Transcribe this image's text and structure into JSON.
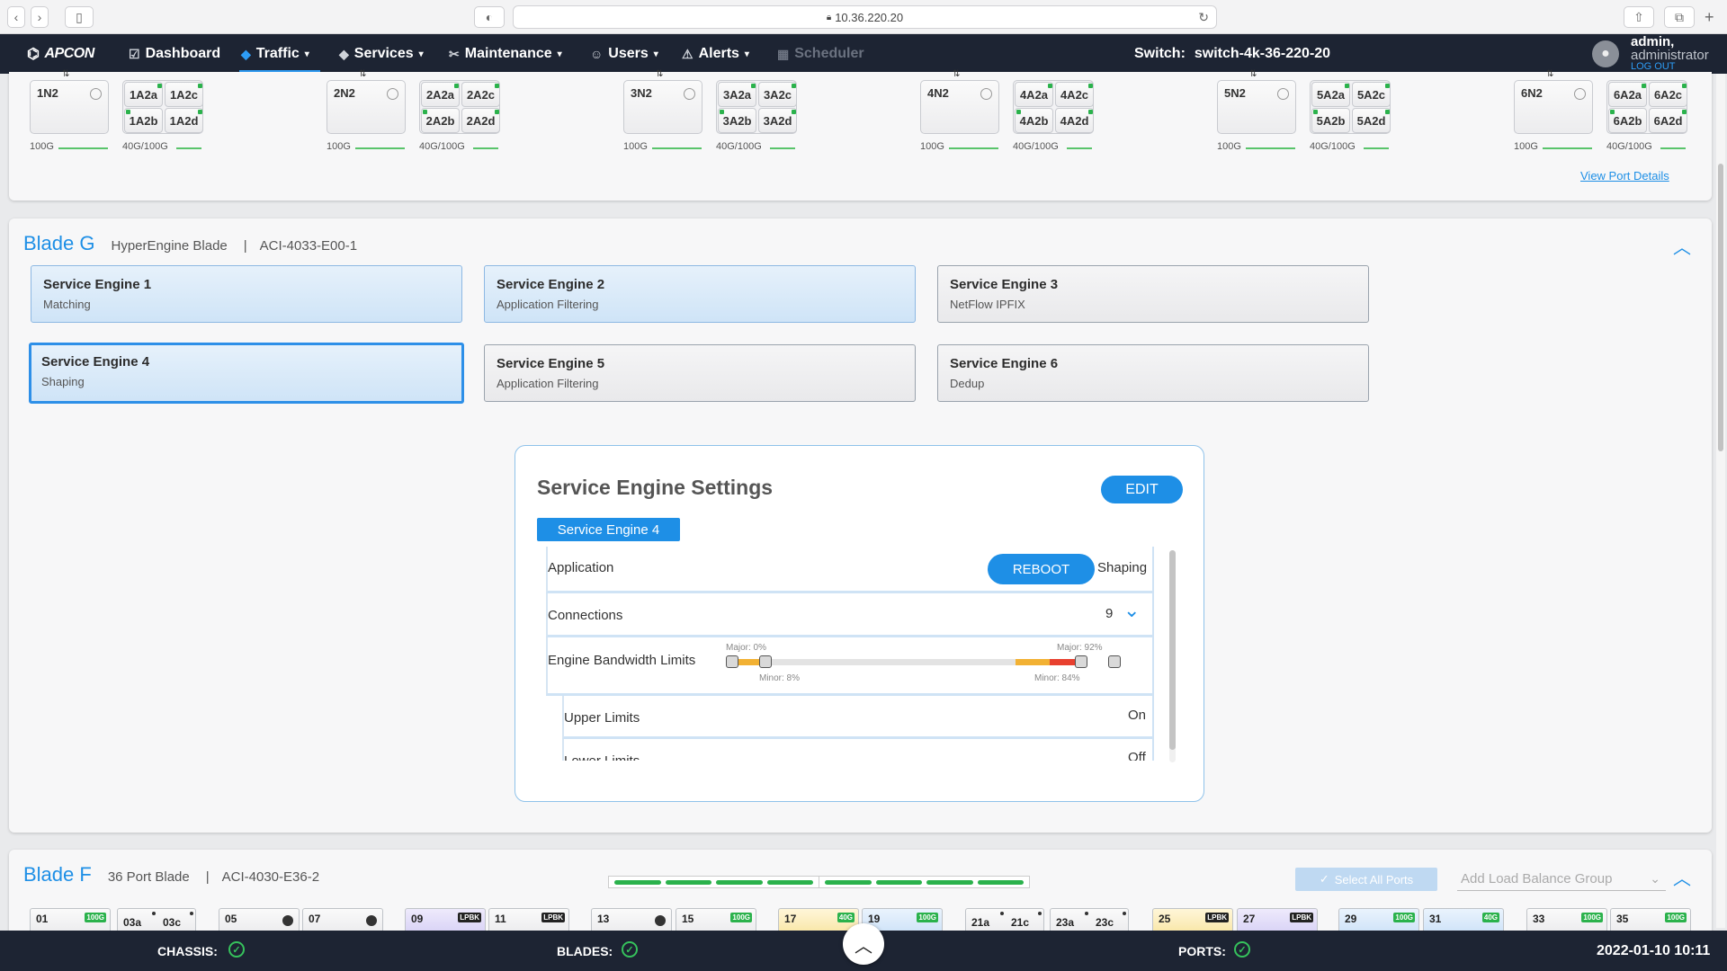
{
  "browser": {
    "url": "10.36.220.20"
  },
  "nav": {
    "logo": "APCON",
    "items": [
      {
        "label": "Dashboard",
        "icon": "dashboard-icon"
      },
      {
        "label": "Traffic",
        "icon": "traffic-icon"
      },
      {
        "label": "Services",
        "icon": "services-icon"
      },
      {
        "label": "Maintenance",
        "icon": "wrench-icon"
      },
      {
        "label": "Users",
        "icon": "users-icon"
      },
      {
        "label": "Alerts",
        "icon": "alert-icon"
      },
      {
        "label": "Scheduler",
        "icon": "calendar-icon"
      }
    ],
    "switch_label": "Switch:",
    "switch_name": "switch-4k-36-220-20",
    "user": "admin,",
    "role": "administrator",
    "logout": "LOG OUT"
  },
  "top_ports": {
    "groups": [
      {
        "n": "1N2",
        "a": [
          "1A2a",
          "1A2c",
          "1A2b",
          "1A2d"
        ],
        "n_speed": "100G",
        "a_speed": "40G/100G"
      },
      {
        "n": "2N2",
        "a": [
          "2A2a",
          "2A2c",
          "2A2b",
          "2A2d"
        ],
        "n_speed": "100G",
        "a_speed": "40G/100G"
      },
      {
        "n": "3N2",
        "a": [
          "3A2a",
          "3A2c",
          "3A2b",
          "3A2d"
        ],
        "n_speed": "100G",
        "a_speed": "40G/100G"
      },
      {
        "n": "4N2",
        "a": [
          "4A2a",
          "4A2c",
          "4A2b",
          "4A2d"
        ],
        "n_speed": "100G",
        "a_speed": "40G/100G"
      },
      {
        "n": "5N2",
        "a": [
          "5A2a",
          "5A2c",
          "5A2b",
          "5A2d"
        ],
        "n_speed": "100G",
        "a_speed": "40G/100G"
      },
      {
        "n": "6N2",
        "a": [
          "6A2a",
          "6A2c",
          "6A2b",
          "6A2d"
        ],
        "n_speed": "100G",
        "a_speed": "40G/100G"
      }
    ],
    "view_details": "View Port Details"
  },
  "blade_g": {
    "title": "Blade G",
    "type": "HyperEngine Blade",
    "sep": "|",
    "model": "ACI-4033-E00-1",
    "engines": [
      {
        "name": "Service Engine 1",
        "app": "Matching"
      },
      {
        "name": "Service Engine 2",
        "app": "Application Filtering"
      },
      {
        "name": "Service Engine 3",
        "app": "NetFlow IPFIX"
      },
      {
        "name": "Service Engine 4",
        "app": "Shaping"
      },
      {
        "name": "Service Engine 5",
        "app": "Application Filtering"
      },
      {
        "name": "Service Engine 6",
        "app": "Dedup"
      }
    ]
  },
  "settings": {
    "title": "Service Engine Settings",
    "edit": "EDIT",
    "tab": "Service Engine 4",
    "application_label": "Application",
    "reboot": "REBOOT",
    "application_value": "Shaping",
    "connections_label": "Connections",
    "connections_value": "9",
    "bandwidth_label": "Engine Bandwidth Limits",
    "major_low": "Major: 0%",
    "minor_low": "Minor: 8%",
    "major_high": "Major: 92%",
    "minor_high": "Minor: 84%",
    "upper_label": "Upper Limits",
    "upper_value": "On",
    "lower_label": "Lower Limits",
    "lower_value": "Off"
  },
  "blade_f": {
    "title": "Blade F",
    "type": "36 Port Blade",
    "sep": "|",
    "model": "ACI-4030-E36-2",
    "select_all": "Select All Ports",
    "add_group_placeholder": "Add Load Balance Group",
    "ports": [
      {
        "label": "01",
        "badge": "100G",
        "badge_color": "#2bb24c"
      },
      {
        "label": "03a",
        "sub": "03c"
      },
      {
        "label": "05",
        "dot": true
      },
      {
        "label": "07",
        "dot": true
      },
      {
        "label": "09",
        "badge": "LPBK",
        "badge_color": "#222",
        "style": "p"
      },
      {
        "label": "11",
        "badge": "LPBK",
        "badge_color": "#222"
      },
      {
        "label": "13",
        "dot": true
      },
      {
        "label": "15",
        "badge": "100G",
        "badge_color": "#2bb24c"
      },
      {
        "label": "17",
        "badge": "40G",
        "badge_color": "#2bb24c",
        "style": "y"
      },
      {
        "label": "19",
        "badge": "100G",
        "badge_color": "#2bb24c",
        "style": "b"
      },
      {
        "label": "21a",
        "sub": "21c"
      },
      {
        "label": "23a",
        "sub": "23c"
      },
      {
        "label": "25",
        "badge": "LPBK",
        "badge_color": "#222",
        "style": "y"
      },
      {
        "label": "27",
        "badge": "LPBK",
        "badge_color": "#222",
        "style": "p"
      },
      {
        "label": "29",
        "badge": "100G",
        "badge_color": "#2bb24c",
        "style": "b"
      },
      {
        "label": "31",
        "badge": "40G",
        "badge_color": "#2bb24c",
        "style": "b"
      },
      {
        "label": "33",
        "badge": "100G",
        "badge_color": "#2bb24c"
      },
      {
        "label": "35",
        "badge": "100G",
        "badge_color": "#2bb24c"
      }
    ]
  },
  "status": {
    "chassis": "CHASSIS:",
    "blades": "BLADES:",
    "ports": "PORTS:",
    "datetime": "2022-01-10 10:11"
  },
  "colors": {
    "accent": "#1e8fe6",
    "nav_bg": "#1d2433",
    "ok_green": "#36c25c"
  }
}
